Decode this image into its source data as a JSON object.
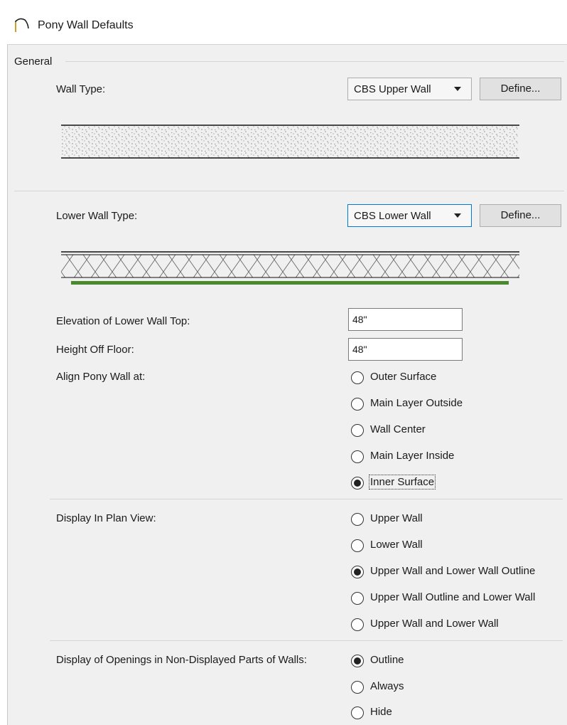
{
  "window": {
    "title": "Pony Wall Defaults"
  },
  "general": {
    "group_label": "General",
    "wall_type_label": "Wall Type:",
    "wall_type_value": "CBS Upper Wall",
    "define_upper_label": "Define...",
    "lower_wall_type_label": "Lower Wall Type:",
    "lower_wall_type_value": "CBS Lower Wall",
    "define_lower_label": "Define...",
    "elevation_label": "Elevation of Lower Wall Top:",
    "elevation_value": "48\"",
    "height_off_floor_label": "Height Off Floor:",
    "height_off_floor_value": "48\"",
    "align_label": "Align Pony Wall at:",
    "align_options": [
      {
        "label": "Outer Surface",
        "checked": false
      },
      {
        "label": "Main Layer Outside",
        "checked": false
      },
      {
        "label": "Wall Center",
        "checked": false
      },
      {
        "label": "Main Layer Inside",
        "checked": false
      },
      {
        "label": "Inner Surface",
        "checked": true
      }
    ],
    "display_plan_label": "Display In Plan View:",
    "display_plan_options": [
      {
        "label": "Upper Wall",
        "checked": false
      },
      {
        "label": "Lower Wall",
        "checked": false
      },
      {
        "label": "Upper Wall and Lower Wall Outline",
        "checked": true
      },
      {
        "label": "Upper Wall Outline and Lower Wall",
        "checked": false
      },
      {
        "label": "Upper Wall and Lower Wall",
        "checked": false
      }
    ],
    "openings_label": "Display of Openings in Non-Displayed Parts of Walls:",
    "openings_options": [
      {
        "label": "Outline",
        "checked": true
      },
      {
        "label": "Always",
        "checked": false
      },
      {
        "label": "Hide",
        "checked": false
      }
    ]
  },
  "colors": {
    "lower_wall_finish": "#4a8a2f",
    "focus_border": "#0078d7"
  }
}
